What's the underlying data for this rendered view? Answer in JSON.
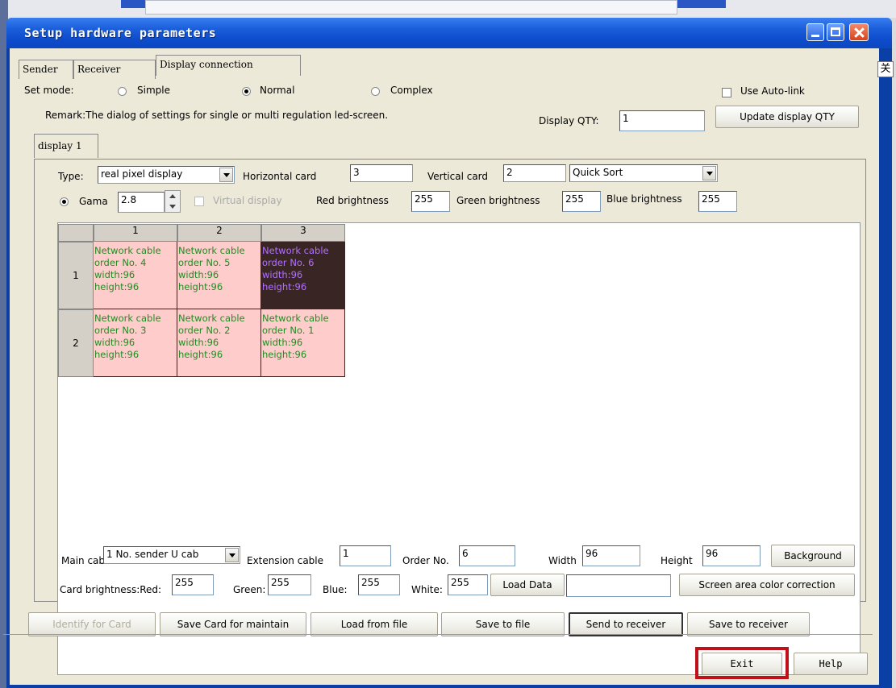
{
  "window": {
    "title": "Setup hardware parameters"
  },
  "side_char": "关",
  "tabs": [
    "Sender",
    "Receiver",
    "Display connection"
  ],
  "set_mode": {
    "label": "Set mode:",
    "options": [
      "Simple",
      "Normal",
      "Complex"
    ],
    "selected": "Normal"
  },
  "use_auto_link": {
    "label": "Use Auto-link",
    "checked": false
  },
  "remark": "Remark:The dialog of settings for single or multi  regulation led-screen.",
  "display_qty": {
    "label": "Display QTY:",
    "value": "1",
    "update_button": "Update display QTY"
  },
  "display_tab": "display 1",
  "type": {
    "label": "Type:",
    "value": "real pixel display"
  },
  "horizontal_card": {
    "label": "Horizontal card",
    "value": "3"
  },
  "vertical_card": {
    "label": "Vertical card",
    "value": "2"
  },
  "sort": {
    "value": "Quick Sort"
  },
  "gama": {
    "label": "Gama",
    "value": "2.8"
  },
  "virtual_display": {
    "label": "Virtual display",
    "checked": false
  },
  "red_brightness": {
    "label": "Red brightness",
    "value": "255"
  },
  "green_brightness": {
    "label": "Green brightness",
    "value": "255"
  },
  "blue_brightness": {
    "label": "Blue brightness",
    "value": "255"
  },
  "grid": {
    "col_headers": [
      "1",
      "2",
      "3"
    ],
    "row_headers": [
      "1",
      "2"
    ],
    "cells": [
      [
        {
          "lines": [
            "Network cable",
            "order No. 4",
            "width:96",
            "height:96"
          ],
          "selected": false
        },
        {
          "lines": [
            "Network cable",
            "order No. 5",
            "width:96",
            "height:96"
          ],
          "selected": false
        },
        {
          "lines": [
            "Network cable",
            "order No. 6",
            "width:96",
            "height:96"
          ],
          "selected": true
        }
      ],
      [
        {
          "lines": [
            "Network cable",
            "order No. 3",
            "width:96",
            "height:96"
          ],
          "selected": false
        },
        {
          "lines": [
            "Network cable",
            "order No. 2",
            "width:96",
            "height:96"
          ],
          "selected": false
        },
        {
          "lines": [
            "Network cable",
            "order No. 1",
            "width:96",
            "height:96"
          ],
          "selected": false
        }
      ]
    ]
  },
  "main_cable": {
    "label": "Main cable",
    "value": "1 No. sender U cab"
  },
  "extension_cable": {
    "label": "Extension cable",
    "value": "1"
  },
  "order_no": {
    "label": "Order No.",
    "value": "6"
  },
  "width": {
    "label": "Width",
    "value": "96"
  },
  "height": {
    "label": "Height",
    "value": "96"
  },
  "background_button": "Background",
  "card_brightness": {
    "red_label": "Card brightness:Red:",
    "red": "255",
    "green_label": "Green:",
    "green": "255",
    "blue_label": "Blue:",
    "blue": "255",
    "white_label": "White:",
    "white": "255"
  },
  "load_data_button": "Load Data",
  "load_data_value": "",
  "screen_area_button": "Screen area color correction",
  "actions": [
    "Identify for Card",
    "Save Card for maintain",
    "Load from file",
    "Save to file",
    "Send to receiver",
    "Save to receiver"
  ],
  "exit_button": "Exit",
  "help_button": "Help",
  "colors": {
    "cell_bg": "#ffcccc",
    "cell_text": "#228b22",
    "selected_bg": "#3a2525",
    "selected_text": "#b070ff",
    "highlight_box": "#c0101a"
  }
}
